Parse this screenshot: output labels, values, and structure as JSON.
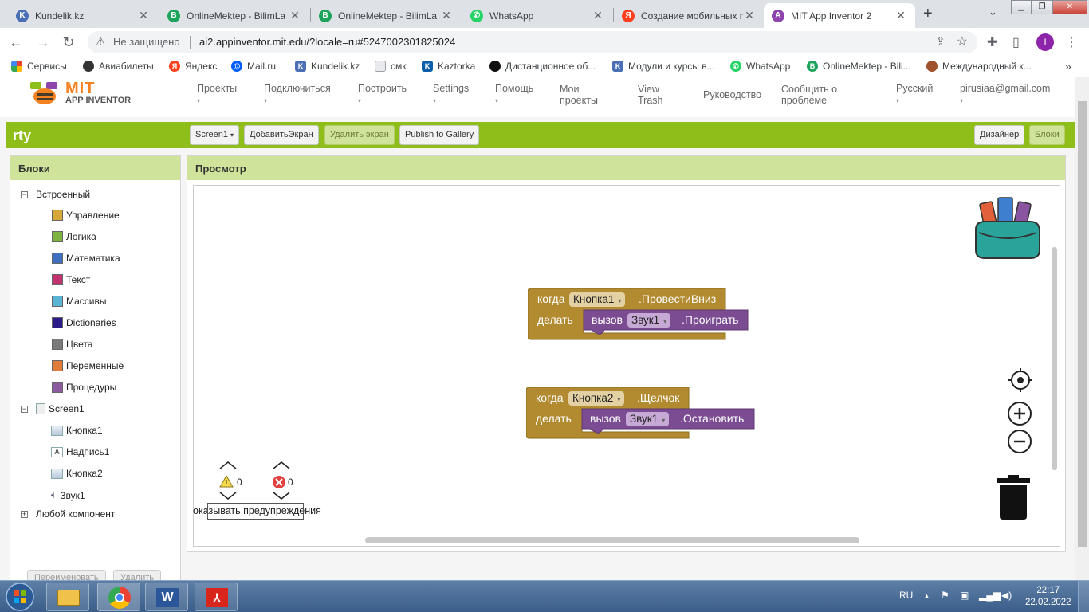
{
  "browser": {
    "tabs": [
      {
        "title": "Kundelik.kz",
        "icon": "kundelik-icon",
        "color": "#4a6fb5"
      },
      {
        "title": "OnlineMektep - BilimLa",
        "icon": "bilimland-icon",
        "color": "#1ea35a"
      },
      {
        "title": "OnlineMektep - BilimLa",
        "icon": "bilimland-icon",
        "color": "#1ea35a"
      },
      {
        "title": "WhatsApp",
        "icon": "whatsapp-icon",
        "color": "#25d366"
      },
      {
        "title": "Создание мобильных п",
        "icon": "yandex-icon",
        "color": "#fc3f1d"
      },
      {
        "title": "MIT App Inventor 2",
        "icon": "appinventor-icon",
        "color": "#8e44ad"
      }
    ],
    "security_label": "Не защищено",
    "url": "ai2.appinventor.mit.edu/?locale=ru#5247002301825024",
    "profile_initial": "I",
    "bookmarks": [
      {
        "label": "Сервисы",
        "icon": "apps-grid-icon",
        "color": "#e94235"
      },
      {
        "label": "Авиабилеты",
        "icon": "globe-icon",
        "color": "#333333"
      },
      {
        "label": "Яндекс",
        "icon": "yandex-icon",
        "color": "#fc3f1d"
      },
      {
        "label": "Mail.ru",
        "icon": "mailru-icon",
        "color": "#005ff9"
      },
      {
        "label": "Kundelik.kz",
        "icon": "kundelik-icon",
        "color": "#4a6fb5"
      },
      {
        "label": "смк",
        "icon": "document-icon",
        "color": "#8ab4f8"
      },
      {
        "label": "Kaztorka",
        "icon": "kaztorka-icon",
        "color": "#0a5fa8"
      },
      {
        "label": "Дистанционное об...",
        "icon": "edu-icon",
        "color": "#111111"
      },
      {
        "label": "Модули и курсы в...",
        "icon": "kundelik-icon",
        "color": "#4a6fb5"
      },
      {
        "label": "WhatsApp",
        "icon": "whatsapp-icon",
        "color": "#25d366"
      },
      {
        "label": "OnlineMektep - Bili...",
        "icon": "bilimland-icon",
        "color": "#1ea35a"
      },
      {
        "label": "Международный к...",
        "icon": "owl-icon",
        "color": "#a0522d"
      }
    ]
  },
  "header": {
    "logo_mit": "MIT",
    "logo_sub": "APP INVENTOR",
    "menus": [
      {
        "l1": "Проекты",
        "l2": ""
      },
      {
        "l1": "Подключиться",
        "l2": ""
      },
      {
        "l1": "Построить",
        "l2": ""
      },
      {
        "l1": "Settings",
        "l2": ""
      },
      {
        "l1": "Помощь",
        "l2": ""
      },
      {
        "l1": "Мои",
        "l2": "проекты"
      },
      {
        "l1": "View",
        "l2": "Trash"
      },
      {
        "l1": "Руководство",
        "l2": ""
      },
      {
        "l1": "Сообщить о",
        "l2": "проблеме"
      },
      {
        "l1": "Русский",
        "l2": ""
      },
      {
        "l1": "pirusiaa@gmail.com",
        "l2": ""
      }
    ]
  },
  "project": {
    "name": "rty",
    "screen_select": "Screen1",
    "add_screen": "ДобавитьЭкран",
    "remove_screen": "Удалить экран",
    "publish": "Publish to Gallery",
    "designer": "Дизайнер",
    "blocks": "Блоки"
  },
  "palette": {
    "title": "Блоки",
    "builtin": "Встроенный",
    "builtin_items": [
      {
        "label": "Управление",
        "color": "#d6a83a"
      },
      {
        "label": "Логика",
        "color": "#7fb341"
      },
      {
        "label": "Математика",
        "color": "#3f6fbf"
      },
      {
        "label": "Текст",
        "color": "#c2326f"
      },
      {
        "label": "Массивы",
        "color": "#5ab4d6"
      },
      {
        "label": "Dictionaries",
        "color": "#2c1c8a"
      },
      {
        "label": "Цвета",
        "color": "#7a7a7a"
      },
      {
        "label": "Переменные",
        "color": "#e07b3c"
      },
      {
        "label": "Процедуры",
        "color": "#8c5a9e"
      }
    ],
    "screen": "Screen1",
    "components": [
      {
        "label": "Кнопка1",
        "icon": "button-component-icon"
      },
      {
        "label": "Надпись1",
        "icon": "label-component-icon"
      },
      {
        "label": "Кнопка2",
        "icon": "button-component-icon"
      },
      {
        "label": "Звук1",
        "icon": "sound-component-icon"
      }
    ],
    "any_component": "Любой компонент",
    "rename_btn": "Переименовать",
    "delete_btn": "Удалить"
  },
  "viewer": {
    "title": "Просмотр",
    "block1": {
      "when": "когда",
      "component": "Кнопка1",
      "event": ".ПровестиВниз",
      "do": "делать",
      "call": "вызов",
      "target": "Звук1",
      "method": ".Проиграть"
    },
    "block2": {
      "when": "когда",
      "component": "Кнопка2",
      "event": ".Щелчок",
      "do": "делать",
      "call": "вызов",
      "target": "Звук1",
      "method": ".Остановить"
    },
    "warnings_count": "0",
    "errors_count": "0",
    "show_warnings": "оказывать предупреждения",
    "colors": {
      "event_block": "#b28a2f",
      "method_block": "#7b4c91",
      "dropdown_event": "#e4d1a3",
      "dropdown_method": "#c7a9d6"
    }
  },
  "taskbar": {
    "lang": "RU",
    "time": "22:17",
    "date": "22.02.2022"
  }
}
